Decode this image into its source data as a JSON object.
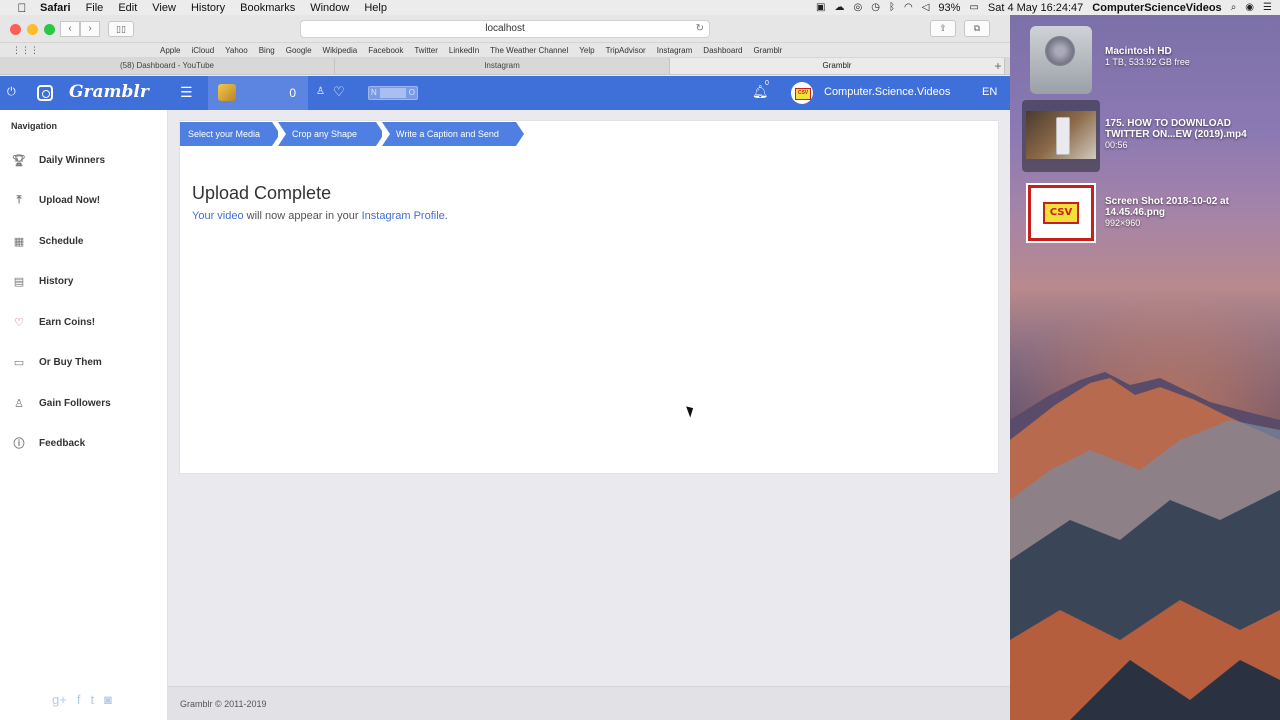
{
  "menubar": {
    "app": "Safari",
    "items": [
      "File",
      "Edit",
      "View",
      "History",
      "Bookmarks",
      "Window",
      "Help"
    ],
    "battery": "93%",
    "clock": "Sat 4 May 16:24:47",
    "user": "ComputerScienceVideos"
  },
  "browser": {
    "url": "localhost",
    "bookmarks": [
      "Apple",
      "iCloud",
      "Yahoo",
      "Bing",
      "Google",
      "Wikipedia",
      "Facebook",
      "Twitter",
      "LinkedIn",
      "The Weather Channel",
      "Yelp",
      "TripAdvisor",
      "Instagram",
      "Dashboard",
      "Gramblr"
    ],
    "tabs": [
      "(58) Dashboard - YouTube",
      "Instagram",
      "Gramblr"
    ]
  },
  "header": {
    "logo": "Gramblr",
    "coins": "0",
    "toggle_left": "N",
    "toggle_right": "O",
    "notifications": "0",
    "username": "Computer.Science.Videos",
    "language": "EN"
  },
  "nav": {
    "heading": "Navigation",
    "items": [
      {
        "label": "Daily Winners",
        "icon": "trophy-icon"
      },
      {
        "label": "Upload Now!",
        "icon": "upload-icon"
      },
      {
        "label": "Schedule",
        "icon": "calendar-icon"
      },
      {
        "label": "History",
        "icon": "history-icon"
      },
      {
        "label": "Earn Coins!",
        "icon": "heart-icon"
      },
      {
        "label": "Or Buy Them",
        "icon": "wallet-icon"
      },
      {
        "label": "Gain Followers",
        "icon": "user-icon"
      },
      {
        "label": "Feedback",
        "icon": "question-icon"
      }
    ]
  },
  "steps": [
    "Select your Media",
    "Crop any Shape",
    "Write a Caption and Send"
  ],
  "content": {
    "title": "Upload Complete",
    "msg_link1": "Your video",
    "msg_mid": " will now appear in your ",
    "msg_link2": "Instagram Profile",
    "msg_end": "."
  },
  "footer": {
    "copyright": "Gramblr © 2011-2019"
  },
  "desktop": {
    "hd_name": "Macintosh HD",
    "hd_info": "1 TB, 533.92 GB free",
    "video_name_1": "175. HOW TO DOWNLOAD",
    "video_name_2": "TWITTER ON...EW (2019).mp4",
    "video_duration": "00:56",
    "shot_name_1": "Screen Shot 2018-10-02 at",
    "shot_name_2": "14.45.46.png",
    "shot_size": "992×960",
    "shot_label": "CSV"
  },
  "colors": {
    "accent": "#3f6fd8",
    "step": "#4f7fe0"
  }
}
